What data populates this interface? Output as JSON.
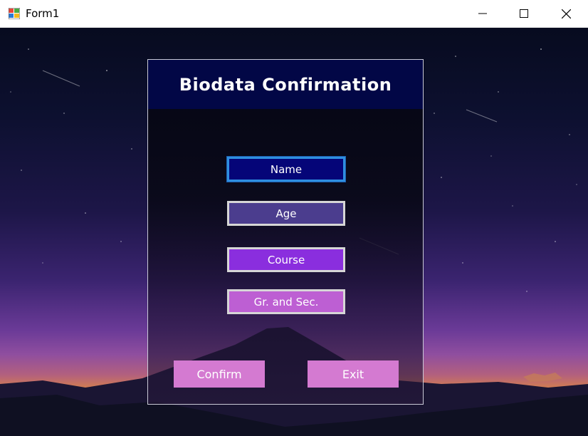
{
  "window": {
    "title": "Form1"
  },
  "panel": {
    "title": "Biodata Confirmation"
  },
  "fields": {
    "name_label": "Name",
    "age_label": "Age",
    "course_label": "Course",
    "grsec_label": "Gr. and Sec."
  },
  "actions": {
    "confirm_label": "Confirm",
    "exit_label": "Exit"
  },
  "colors": {
    "header_bg": "#020746",
    "name_bg": "#050578",
    "age_bg": "#4b3d8e",
    "course_bg": "#8a2ede",
    "grsec_bg": "#bd5fd3",
    "action_bg": "#d47ad1",
    "focus_border": "#2f8fe0"
  },
  "icons": {
    "app": "windows-form-icon",
    "minimize": "minimize-icon",
    "maximize": "maximize-icon",
    "close": "close-icon"
  }
}
